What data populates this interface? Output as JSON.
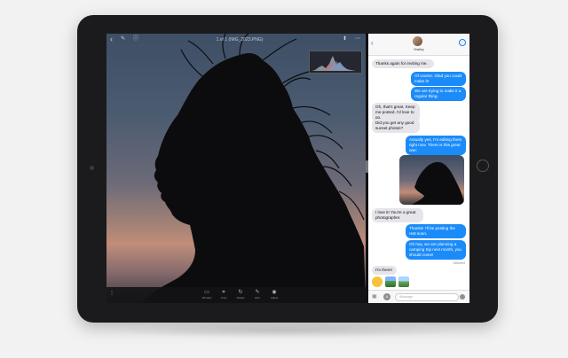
{
  "photos": {
    "title": "1 of 1 (IMG_2023.PNG)",
    "top_icons": [
      "back-icon",
      "edit-icon",
      "info-icon",
      "share-icon",
      "more-icon"
    ],
    "toolbar": [
      {
        "icon": "window-icon",
        "label": "Window"
      },
      {
        "icon": "crop-icon",
        "label": "Crop"
      },
      {
        "icon": "rotate-icon",
        "label": "Rotate"
      },
      {
        "icon": "edit-icon",
        "label": "Edit"
      },
      {
        "icon": "adjust-icon",
        "label": "Adjust"
      }
    ]
  },
  "messages": {
    "contact_name": "Shelley",
    "thread": [
      {
        "dir": "in",
        "text": "Thanks again for inviting me."
      },
      {
        "dir": "out",
        "text": "Of course. Glad you could make it!"
      },
      {
        "dir": "out",
        "text": "We are trying to make it a regular thing."
      },
      {
        "dir": "in",
        "text": "Oh, that's great. Keep me posted. I'd love to go."
      },
      {
        "dir": "in",
        "text": "Did you get any good sunset photos?"
      },
      {
        "dir": "out",
        "text": "Actually yes, I'm editing them right now. There is this great one:"
      },
      {
        "dir": "in",
        "text": "I love it! You're a great photographer."
      },
      {
        "dir": "out",
        "text": "Thanks! I'll be posting the rest soon."
      },
      {
        "dir": "out",
        "text": "Oh hey, we are planning a camping trip next month, you should come!"
      },
      {
        "dir": "in",
        "text": "I'm there!"
      }
    ],
    "delivered_label": "Delivered",
    "input_placeholder": "iMessage"
  },
  "colors": {
    "accent": "#1b8bf9",
    "incoming_bubble": "#e5e5ea",
    "device_frame": "#1b1b1d"
  }
}
